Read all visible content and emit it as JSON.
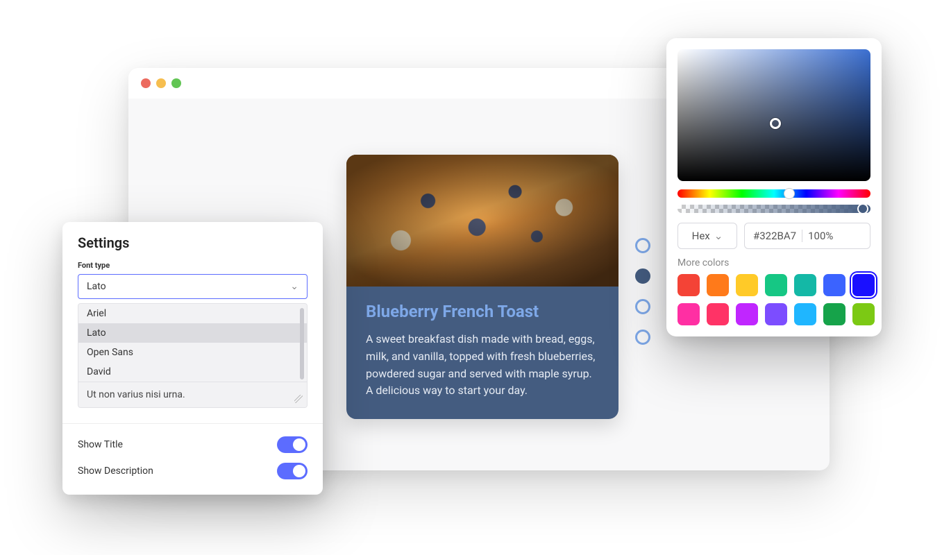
{
  "settings": {
    "title": "Settings",
    "font_type_label": "Font type",
    "selected_font": "Lato",
    "font_options": [
      "Ariel",
      "Lato",
      "Open Sans",
      "David"
    ],
    "sample_text": "Ut non varius nisi urna.",
    "toggles": {
      "show_title": {
        "label": "Show Title",
        "on": true
      },
      "show_description": {
        "label": "Show Description",
        "on": true
      }
    }
  },
  "card": {
    "title": "Blueberry French Toast",
    "description": "A sweet breakfast dish made with bread, eggs, milk, and vanilla, topped with fresh blueberries, powdered sugar and served with maple syrup. A delicious way to start your day.",
    "active_dot_index": 1,
    "dot_count": 4
  },
  "picker": {
    "format_label": "Hex",
    "hex_value": "#322BA7",
    "opacity": "100%",
    "more_colors_label": "More colors",
    "selected_swatch_index": 6,
    "swatches": [
      "#f44336",
      "#ff7a1a",
      "#ffca28",
      "#16c784",
      "#14b8a6",
      "#3b63ff",
      "#1a10ff",
      "#ff2fa3",
      "#ff3366",
      "#c026ff",
      "#7c4dff",
      "#1fb6ff",
      "#16a34a",
      "#7cc914"
    ]
  }
}
